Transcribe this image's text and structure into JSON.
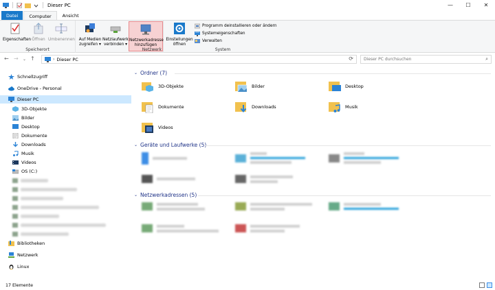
{
  "window": {
    "title": "Dieser PC",
    "minimize": "—",
    "maximize": "☐",
    "close": "✕"
  },
  "tabs": [
    "Datei",
    "Computer",
    "Ansicht"
  ],
  "ribbon": {
    "speicherort": {
      "label": "Speicherort",
      "eigenschaften": "Eigenschaften",
      "oeffnen": "Öffnen",
      "umbenennen": "Umbenennen"
    },
    "netzwerk": {
      "label": "Netzwerk",
      "auf_medien_1": "Auf Medien",
      "auf_medien_2": "zugreifen ▾",
      "netzlaufwerk_1": "Netzlaufwerk",
      "netzlaufwerk_2": "verbinden ▾",
      "netzwerkadresse_1": "Netzwerkadresse",
      "netzwerkadresse_2": "hinzufügen"
    },
    "system": {
      "label": "System",
      "einstellungen_1": "Einstellungen",
      "einstellungen_2": "öffnen",
      "programm": "Programm deinstallieren oder ändern",
      "systemeigenschaften": "Systemeigenschaften",
      "verwalten": "Verwalten"
    }
  },
  "address": {
    "path": "Dieser PC",
    "search_placeholder": "Dieser PC durchsuchen"
  },
  "sidebar": {
    "schnellzugriff": "Schnellzugriff",
    "onedrive": "OneDrive - Personal",
    "dieser_pc": "Dieser PC",
    "children": [
      "3D-Objekte",
      "Bilder",
      "Desktop",
      "Dokumente",
      "Downloads",
      "Musik",
      "Videos",
      "OS (C:)"
    ],
    "bibliotheken": "Bibliotheken",
    "netzwerk": "Netzwerk",
    "linux": "Linux"
  },
  "main": {
    "ordner_header": "Ordner (7)",
    "folders": [
      "3D-Objekte",
      "Bilder",
      "Desktop",
      "Dokumente",
      "Downloads",
      "Musik",
      "Videos"
    ],
    "geraete_header": "Geräte und Laufwerke (5)",
    "netzwerk_header": "Netzwerkadressen (5)"
  },
  "status": {
    "count": "17 Elemente"
  },
  "colors": {
    "accent": "#1979ca",
    "selected": "#cce8ff",
    "highlight": "#f7d2d3",
    "section_header": "#1e3287",
    "folder": "#f1c14e"
  }
}
